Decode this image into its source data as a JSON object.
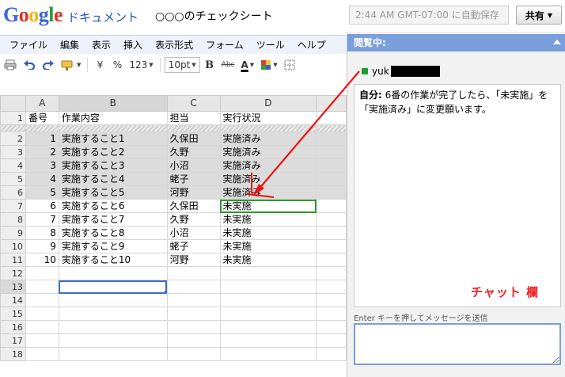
{
  "header": {
    "logo_google": "Google",
    "logo_docs": "ドキュメント",
    "doc_title": "○○○のチェックシート",
    "autosave_status": "2:44 AM GMT-07:00 に自動保存",
    "share_label": "共有"
  },
  "menubar": [
    "ファイル",
    "編集",
    "表示",
    "挿入",
    "表示形式",
    "フォーム",
    "ツール",
    "ヘルプ"
  ],
  "toolbar": {
    "currency_label": "¥",
    "percent_label": "%",
    "number_format_label": "123",
    "font_size": "10pt",
    "bold_label": "B",
    "strike_label": "Abc",
    "text_color_label": "A"
  },
  "sheet": {
    "columns": [
      "A",
      "B",
      "C",
      "D"
    ],
    "header_row": {
      "row": "1",
      "cells": [
        "番号",
        "作業内容",
        "担当",
        "実行状況"
      ]
    },
    "rows": [
      {
        "row": "2",
        "cells": [
          "1",
          "実施すること1",
          "久保田",
          "実施済み"
        ]
      },
      {
        "row": "3",
        "cells": [
          "2",
          "実施すること2",
          "久野",
          "実施済み"
        ]
      },
      {
        "row": "4",
        "cells": [
          "3",
          "実施すること3",
          "小沼",
          "実施済み"
        ]
      },
      {
        "row": "5",
        "cells": [
          "4",
          "実施すること4",
          "蛯子",
          "実施済み"
        ]
      },
      {
        "row": "6",
        "cells": [
          "5",
          "実施すること5",
          "河野",
          "実施済み"
        ]
      },
      {
        "row": "7",
        "cells": [
          "6",
          "実施すること6",
          "久保田",
          "未実施"
        ]
      },
      {
        "row": "8",
        "cells": [
          "7",
          "実施すること7",
          "久野",
          "未実施"
        ]
      },
      {
        "row": "9",
        "cells": [
          "8",
          "実施すること8",
          "小沼",
          "未実施"
        ]
      },
      {
        "row": "10",
        "cells": [
          "9",
          "実施すること9",
          "蛯子",
          "未実施"
        ]
      },
      {
        "row": "11",
        "cells": [
          "10",
          "実施すること10",
          "河野",
          "未実施"
        ]
      },
      {
        "row": "12",
        "cells": [
          "",
          "",
          "",
          ""
        ]
      },
      {
        "row": "13",
        "cells": [
          "",
          "",
          "",
          ""
        ]
      },
      {
        "row": "14",
        "cells": [
          "",
          "",
          "",
          ""
        ]
      },
      {
        "row": "15",
        "cells": [
          "",
          "",
          "",
          ""
        ]
      },
      {
        "row": "16",
        "cells": [
          "",
          "",
          "",
          ""
        ]
      },
      {
        "row": "17",
        "cells": [
          "",
          "",
          "",
          ""
        ]
      },
      {
        "row": "18",
        "cells": [
          "",
          "",
          "",
          ""
        ]
      }
    ]
  },
  "chat": {
    "header_title": "閲覧中:",
    "viewer_name": "yuk",
    "message_sender": "自分:",
    "message_text": " 6番の作業が完了したら、「未実施」を「実施済み」に変更願います。",
    "annotation": "チャット 欄",
    "input_hint": "Enter キーを押してメッセージを送信",
    "input_value": ""
  },
  "colors": {
    "chat_header": "#7a9fdc",
    "annotation_red": "#ee2222",
    "done_shade": "#dcdcdc",
    "status_green": "#19a02b"
  }
}
